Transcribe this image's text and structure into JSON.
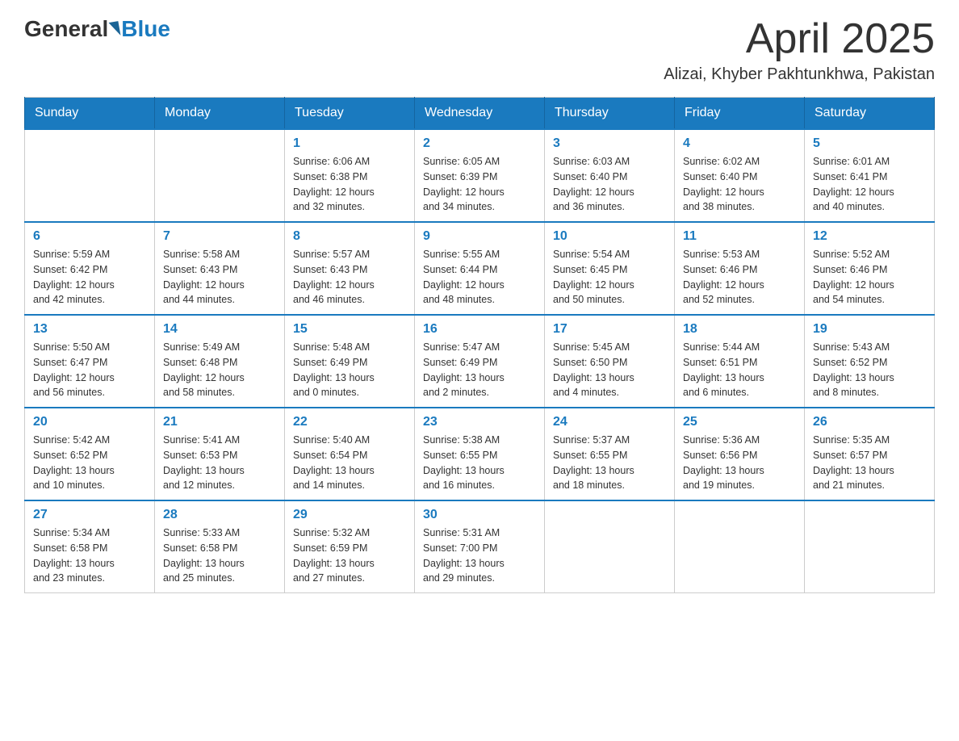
{
  "header": {
    "logo_general": "General",
    "logo_blue": "Blue",
    "month_title": "April 2025",
    "location": "Alizai, Khyber Pakhtunkhwa, Pakistan"
  },
  "days_of_week": [
    "Sunday",
    "Monday",
    "Tuesday",
    "Wednesday",
    "Thursday",
    "Friday",
    "Saturday"
  ],
  "weeks": [
    [
      {
        "day": "",
        "info": ""
      },
      {
        "day": "",
        "info": ""
      },
      {
        "day": "1",
        "info": "Sunrise: 6:06 AM\nSunset: 6:38 PM\nDaylight: 12 hours\nand 32 minutes."
      },
      {
        "day": "2",
        "info": "Sunrise: 6:05 AM\nSunset: 6:39 PM\nDaylight: 12 hours\nand 34 minutes."
      },
      {
        "day": "3",
        "info": "Sunrise: 6:03 AM\nSunset: 6:40 PM\nDaylight: 12 hours\nand 36 minutes."
      },
      {
        "day": "4",
        "info": "Sunrise: 6:02 AM\nSunset: 6:40 PM\nDaylight: 12 hours\nand 38 minutes."
      },
      {
        "day": "5",
        "info": "Sunrise: 6:01 AM\nSunset: 6:41 PM\nDaylight: 12 hours\nand 40 minutes."
      }
    ],
    [
      {
        "day": "6",
        "info": "Sunrise: 5:59 AM\nSunset: 6:42 PM\nDaylight: 12 hours\nand 42 minutes."
      },
      {
        "day": "7",
        "info": "Sunrise: 5:58 AM\nSunset: 6:43 PM\nDaylight: 12 hours\nand 44 minutes."
      },
      {
        "day": "8",
        "info": "Sunrise: 5:57 AM\nSunset: 6:43 PM\nDaylight: 12 hours\nand 46 minutes."
      },
      {
        "day": "9",
        "info": "Sunrise: 5:55 AM\nSunset: 6:44 PM\nDaylight: 12 hours\nand 48 minutes."
      },
      {
        "day": "10",
        "info": "Sunrise: 5:54 AM\nSunset: 6:45 PM\nDaylight: 12 hours\nand 50 minutes."
      },
      {
        "day": "11",
        "info": "Sunrise: 5:53 AM\nSunset: 6:46 PM\nDaylight: 12 hours\nand 52 minutes."
      },
      {
        "day": "12",
        "info": "Sunrise: 5:52 AM\nSunset: 6:46 PM\nDaylight: 12 hours\nand 54 minutes."
      }
    ],
    [
      {
        "day": "13",
        "info": "Sunrise: 5:50 AM\nSunset: 6:47 PM\nDaylight: 12 hours\nand 56 minutes."
      },
      {
        "day": "14",
        "info": "Sunrise: 5:49 AM\nSunset: 6:48 PM\nDaylight: 12 hours\nand 58 minutes."
      },
      {
        "day": "15",
        "info": "Sunrise: 5:48 AM\nSunset: 6:49 PM\nDaylight: 13 hours\nand 0 minutes."
      },
      {
        "day": "16",
        "info": "Sunrise: 5:47 AM\nSunset: 6:49 PM\nDaylight: 13 hours\nand 2 minutes."
      },
      {
        "day": "17",
        "info": "Sunrise: 5:45 AM\nSunset: 6:50 PM\nDaylight: 13 hours\nand 4 minutes."
      },
      {
        "day": "18",
        "info": "Sunrise: 5:44 AM\nSunset: 6:51 PM\nDaylight: 13 hours\nand 6 minutes."
      },
      {
        "day": "19",
        "info": "Sunrise: 5:43 AM\nSunset: 6:52 PM\nDaylight: 13 hours\nand 8 minutes."
      }
    ],
    [
      {
        "day": "20",
        "info": "Sunrise: 5:42 AM\nSunset: 6:52 PM\nDaylight: 13 hours\nand 10 minutes."
      },
      {
        "day": "21",
        "info": "Sunrise: 5:41 AM\nSunset: 6:53 PM\nDaylight: 13 hours\nand 12 minutes."
      },
      {
        "day": "22",
        "info": "Sunrise: 5:40 AM\nSunset: 6:54 PM\nDaylight: 13 hours\nand 14 minutes."
      },
      {
        "day": "23",
        "info": "Sunrise: 5:38 AM\nSunset: 6:55 PM\nDaylight: 13 hours\nand 16 minutes."
      },
      {
        "day": "24",
        "info": "Sunrise: 5:37 AM\nSunset: 6:55 PM\nDaylight: 13 hours\nand 18 minutes."
      },
      {
        "day": "25",
        "info": "Sunrise: 5:36 AM\nSunset: 6:56 PM\nDaylight: 13 hours\nand 19 minutes."
      },
      {
        "day": "26",
        "info": "Sunrise: 5:35 AM\nSunset: 6:57 PM\nDaylight: 13 hours\nand 21 minutes."
      }
    ],
    [
      {
        "day": "27",
        "info": "Sunrise: 5:34 AM\nSunset: 6:58 PM\nDaylight: 13 hours\nand 23 minutes."
      },
      {
        "day": "28",
        "info": "Sunrise: 5:33 AM\nSunset: 6:58 PM\nDaylight: 13 hours\nand 25 minutes."
      },
      {
        "day": "29",
        "info": "Sunrise: 5:32 AM\nSunset: 6:59 PM\nDaylight: 13 hours\nand 27 minutes."
      },
      {
        "day": "30",
        "info": "Sunrise: 5:31 AM\nSunset: 7:00 PM\nDaylight: 13 hours\nand 29 minutes."
      },
      {
        "day": "",
        "info": ""
      },
      {
        "day": "",
        "info": ""
      },
      {
        "day": "",
        "info": ""
      }
    ]
  ]
}
